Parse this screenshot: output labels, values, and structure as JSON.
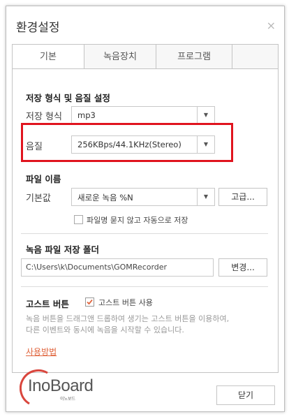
{
  "dialog": {
    "title": "환경설정",
    "close_glyph": "×"
  },
  "tabs": [
    {
      "label": "기본",
      "active": true
    },
    {
      "label": "녹음장치",
      "active": false
    },
    {
      "label": "프로그램",
      "active": false
    },
    {
      "label": "",
      "active": false
    }
  ],
  "storage": {
    "section_title": "저장 형식 및 음질 설정",
    "format_label": "저장 형식",
    "format_value": "mp3",
    "quality_label": "음질",
    "quality_value": "256KBps/44.1KHz(Stereo)"
  },
  "filename": {
    "section_title": "파일 이름",
    "default_label": "기본값",
    "default_value": "새로운 녹음 %N",
    "advanced_button": "고급...",
    "no_ask_checkbox": "파일명 묻지 않고 자동으로 저장",
    "no_ask_checked": false
  },
  "folder": {
    "section_title": "녹음 파일 저장 폴더",
    "path": "C:\\Users\\k\\Documents\\GOMRecorder",
    "change_button": "변경..."
  },
  "ghost": {
    "section_title": "고스트 버튼",
    "use_checkbox": "고스트 버튼 사용",
    "use_checked": true,
    "desc_line1": "녹음 버튼을 드래그앤 드롭하여 생기는 고스트 버튼을 이용하여,",
    "desc_line2": "다른 이벤트와 동시에 녹음을 시작할 수 있습니다.",
    "help_link": "사용방법"
  },
  "footer": {
    "close_button": "닫기"
  },
  "watermark": {
    "logo_text": "InoBoard",
    "logo_sub": "이노보드"
  },
  "colors": {
    "highlight": "#e0141e",
    "link": "#e0643c",
    "check": "#e0643c"
  }
}
